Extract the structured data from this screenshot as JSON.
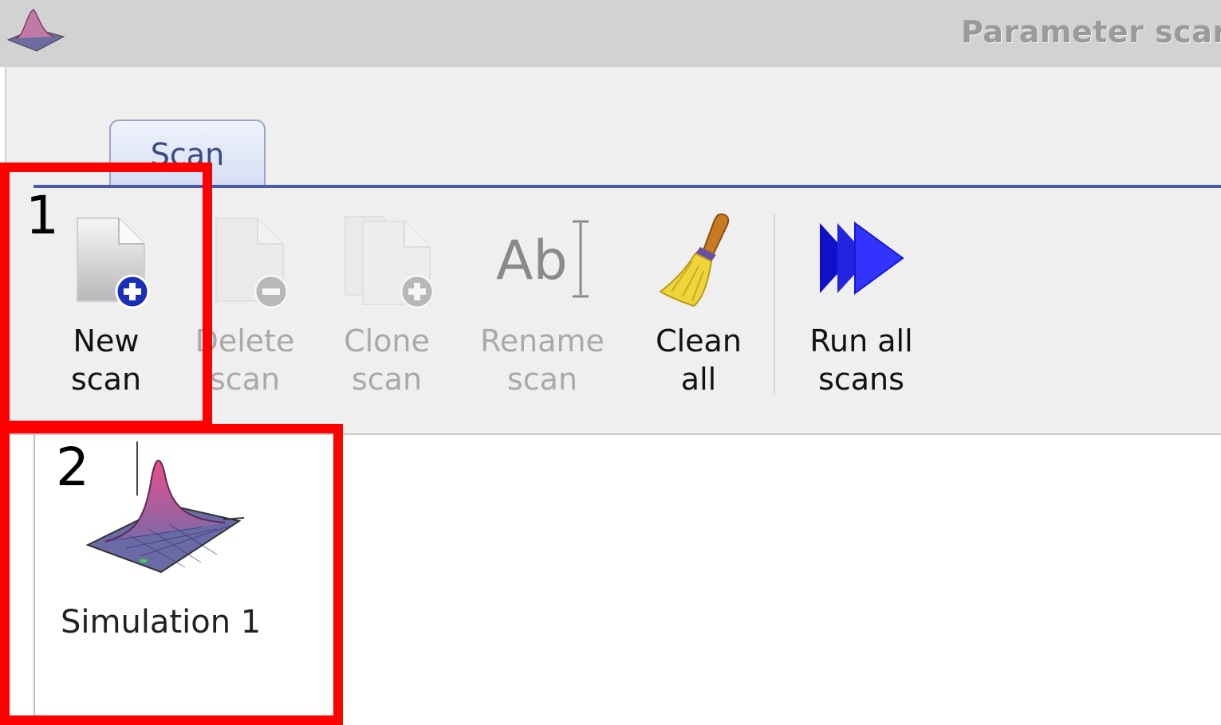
{
  "window": {
    "title": "Parameter scan",
    "app_icon": "surface-plot-icon"
  },
  "tabs": [
    {
      "label": "Scan",
      "selected": true
    }
  ],
  "toolbar": {
    "buttons": [
      {
        "id": "new",
        "label_lines": [
          "New",
          "scan"
        ],
        "icon": "new-document-icon",
        "enabled": true
      },
      {
        "id": "delete",
        "label_lines": [
          "Delete",
          "scan"
        ],
        "icon": "delete-document-icon",
        "enabled": false
      },
      {
        "id": "clone",
        "label_lines": [
          "Clone",
          "scan"
        ],
        "icon": "clone-document-icon",
        "enabled": false
      },
      {
        "id": "rename",
        "label_lines": [
          "Rename",
          "scan"
        ],
        "icon": "rename-text-icon",
        "enabled": false
      },
      {
        "id": "clean",
        "label_lines": [
          "Clean",
          "all"
        ],
        "icon": "broom-icon",
        "enabled": true
      },
      {
        "id": "runall",
        "label_lines": [
          "Run all",
          "scans"
        ],
        "icon": "fast-forward-icon",
        "enabled": true
      }
    ]
  },
  "scan_list": {
    "items": [
      {
        "label": "Simulation 1",
        "icon": "surface-plot-icon"
      }
    ]
  },
  "annotations": [
    {
      "number": "1",
      "color": "#ff0000"
    },
    {
      "number": "2",
      "color": "#ff0000"
    }
  ],
  "colors": {
    "accent": "#4b5aa8",
    "annotation": "#ff0000",
    "disabled_text": "#a9a9a9",
    "run_arrows": "#2222ee",
    "badge": "#1a2fb8"
  }
}
